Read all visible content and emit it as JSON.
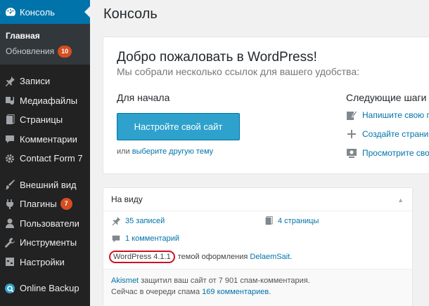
{
  "sidebar": {
    "top_item": {
      "label": "Консоль",
      "icon": "dashboard-icon"
    },
    "submenu": {
      "home": "Главная",
      "updates": "Обновления",
      "updates_badge": "10"
    },
    "items": [
      {
        "label": "Записи",
        "icon": "pin-icon"
      },
      {
        "label": "Медиафайлы",
        "icon": "media-icon"
      },
      {
        "label": "Страницы",
        "icon": "page-icon"
      },
      {
        "label": "Комментарии",
        "icon": "comment-icon"
      },
      {
        "label": "Contact Form 7",
        "icon": "gear-icon"
      },
      {
        "label": "Внешний вид",
        "icon": "brush-icon"
      },
      {
        "label": "Плагины",
        "icon": "plug-icon",
        "badge": "7"
      },
      {
        "label": "Пользователи",
        "icon": "user-icon"
      },
      {
        "label": "Инструменты",
        "icon": "wrench-icon"
      },
      {
        "label": "Настройки",
        "icon": "settings-icon"
      },
      {
        "label": "Online Backup",
        "icon": "backup-icon"
      }
    ]
  },
  "page": {
    "title": "Консоль"
  },
  "welcome": {
    "title": "Добро пожаловать в WordPress!",
    "about": "Мы собрали несколько ссылок для вашего удобства:",
    "start_title": "Для начала",
    "customize_button": "Настройте свой сайт",
    "or_text": "или",
    "choose_theme_link": "выберите другую тему",
    "next_title": "Следующие шаги",
    "next_steps": [
      {
        "label": "Напишите свою п",
        "icon": "edit-icon"
      },
      {
        "label": "Создайте страни",
        "icon": "plus-icon"
      },
      {
        "label": "Просмотрите сво",
        "icon": "view-icon"
      }
    ]
  },
  "glance": {
    "title": "На виду",
    "posts": "35 записей",
    "pages": "4 страницы",
    "comments": "1 комментарий",
    "version": "WordPress 4.1.1",
    "theme_text": "темой оформления",
    "theme_name": "DelaemSait",
    "period": ".",
    "akismet_link": "Akismet",
    "akismet_text": "защитил ваш сайт от 7 901 спам-комментария.",
    "queue_text": "Сейчас в очереди спама",
    "queue_link": "169 комментариев",
    "queue_end": "."
  },
  "colors": {
    "sidebar_bg": "#222222",
    "active_bg": "#0073aa",
    "button_bg": "#2ea2cc",
    "link": "#0073aa",
    "badge": "#d54e21",
    "highlight": "#d01020"
  }
}
